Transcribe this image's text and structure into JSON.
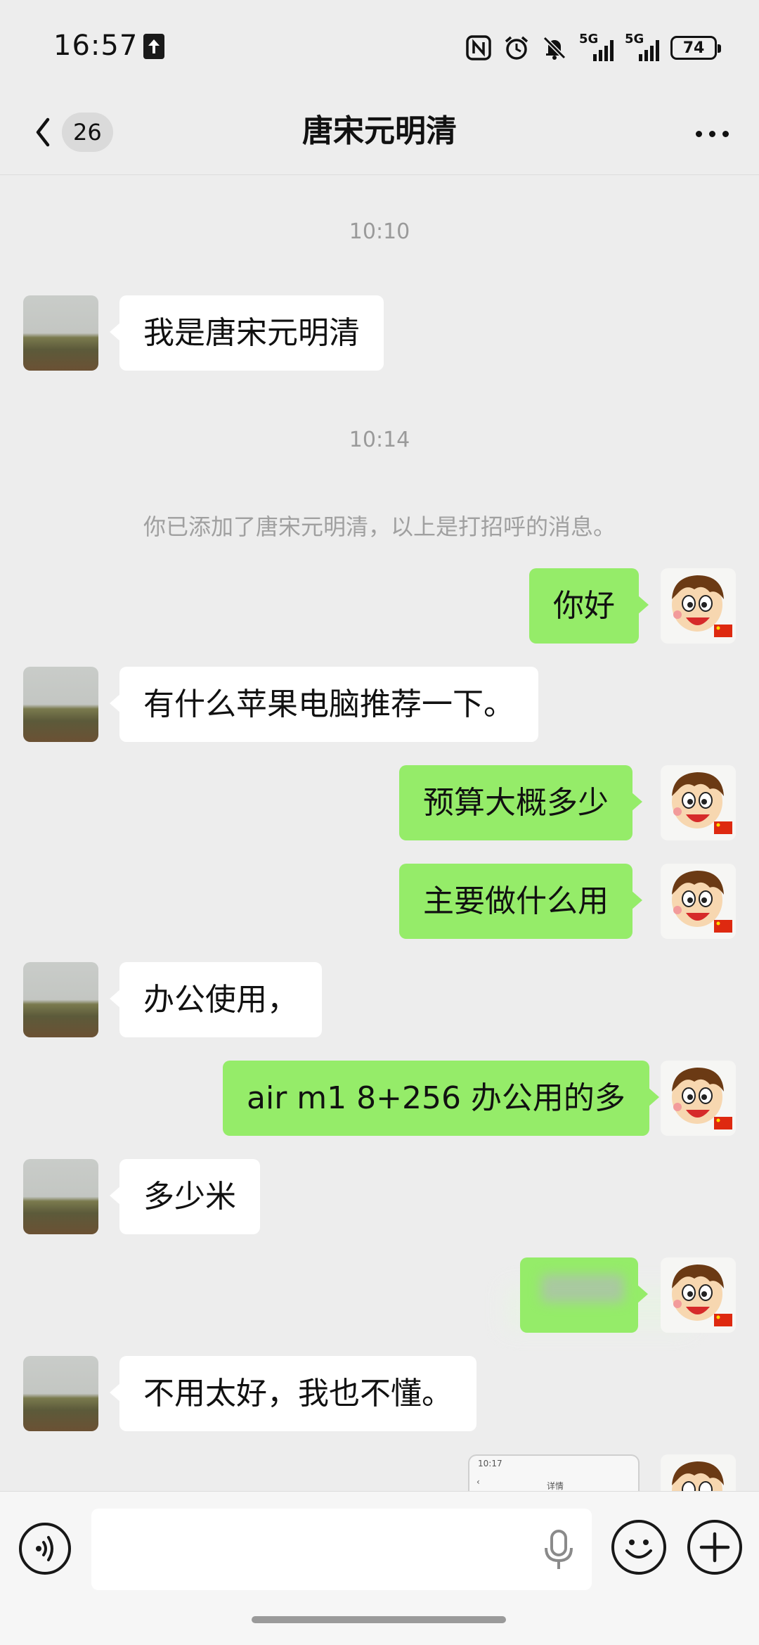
{
  "status_bar": {
    "time": "16:57",
    "signal_label_1": "5G",
    "signal_label_2": "5G",
    "battery": "74"
  },
  "nav": {
    "back_count": "26",
    "title": "唐宋元明清"
  },
  "chat": {
    "timestamps": [
      "10:10",
      "10:14"
    ],
    "system_message": "你已添加了唐宋元明清，以上是打招呼的消息。",
    "messages": [
      {
        "side": "in",
        "text": "我是唐宋元明清"
      },
      {
        "side": "out",
        "text": "你好"
      },
      {
        "side": "in",
        "text": "有什么苹果电脑推荐一下。"
      },
      {
        "side": "out",
        "text": "预算大概多少"
      },
      {
        "side": "out",
        "text": "主要做什么用"
      },
      {
        "side": "in",
        "text": "办公使用，"
      },
      {
        "side": "out",
        "text": "air m1 8+256 办公用的多"
      },
      {
        "side": "in",
        "text": "多少米"
      },
      {
        "side": "out",
        "text": ""
      },
      {
        "side": "in",
        "text": "不用太好，我也不懂。"
      }
    ],
    "partial_image": {
      "time": "10:17",
      "title": "详情"
    }
  },
  "input": {
    "placeholder": ""
  },
  "colors": {
    "out_bubble": "#95ec69",
    "in_bubble": "#ffffff",
    "background": "#ededed"
  }
}
